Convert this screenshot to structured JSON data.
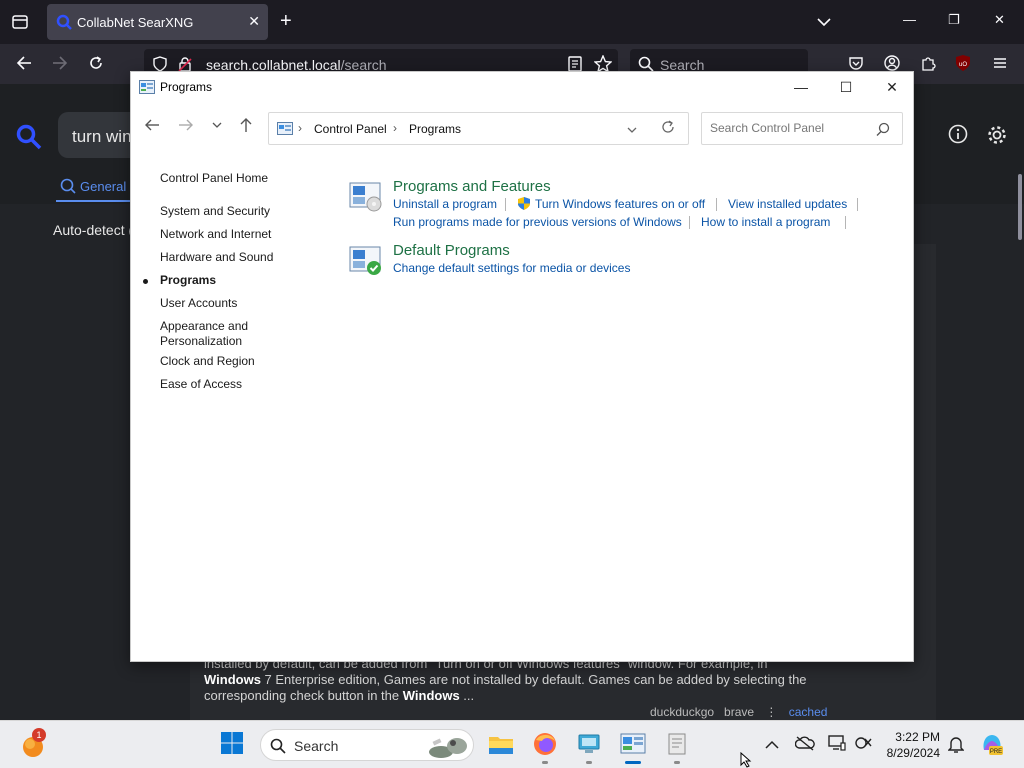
{
  "browser": {
    "tab_title": "CollabNet SearXNG",
    "url_prefix": "search.collabnet.local",
    "url_path": "/search",
    "search_placeholder": "Search"
  },
  "searxng": {
    "query": "turn wind",
    "tab_general": "General",
    "autodetect": "Auto-detect (",
    "snippet_line1": "installed by default, can be added from \"Turn on or off Windows features\" window. For example, in",
    "snippet_windows1": "Windows",
    "snippet_line2": " 7 Enterprise edition, Games are not installed by default. Games can be added by selecting the",
    "snippet_line3a": "corresponding check button in the ",
    "snippet_windows2": "Windows",
    "snippet_line3b": " ...",
    "engines": "duckduckgo   brave",
    "sep": "⋮",
    "cached": "cached"
  },
  "control_panel": {
    "title": "Programs",
    "breadcrumb": [
      "Control Panel",
      "Programs"
    ],
    "search_placeholder": "Search Control Panel",
    "left_nav": [
      {
        "label": "Control Panel Home",
        "active": false
      },
      {
        "label": "System and Security",
        "active": false
      },
      {
        "label": "Network and Internet",
        "active": false
      },
      {
        "label": "Hardware and Sound",
        "active": false
      },
      {
        "label": "Programs",
        "active": true
      },
      {
        "label": "User Accounts",
        "active": false
      },
      {
        "label": "Appearance and Personalization",
        "active": false
      },
      {
        "label": "Clock and Region",
        "active": false
      },
      {
        "label": "Ease of Access",
        "active": false
      }
    ],
    "categories": [
      {
        "title": "Programs and Features",
        "links": [
          "Uninstall a program",
          "Turn Windows features on or off",
          "View installed updates",
          "Run programs made for previous versions of Windows",
          "How to install a program"
        ]
      },
      {
        "title": "Default Programs",
        "links": [
          "Change default settings for media or devices"
        ]
      }
    ]
  },
  "taskbar": {
    "search_label": "Search",
    "time": "3:22 PM",
    "date": "8/29/2024",
    "notification_count": "1"
  }
}
